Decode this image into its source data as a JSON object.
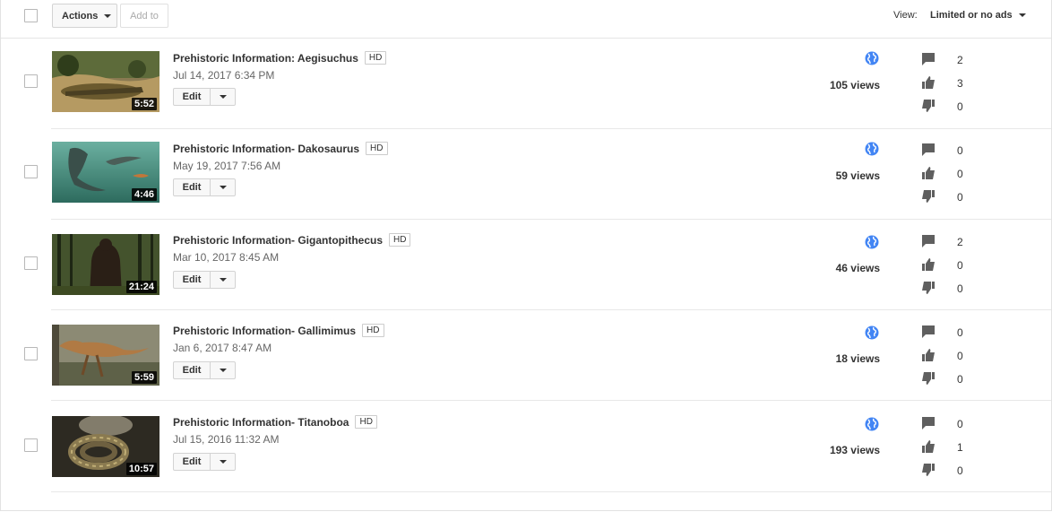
{
  "toolbar": {
    "actions_label": "Actions",
    "add_to_label": "Add to",
    "view_label": "View:",
    "view_value": "Limited or no ads"
  },
  "videos": [
    {
      "title": "Prehistoric Information: Aegisuchus",
      "badge": "HD",
      "date": "Jul 14, 2017 6:34 PM",
      "duration": "5:52",
      "views": "105 views",
      "comments": "2",
      "likes": "3",
      "dislikes": "0",
      "edit": "Edit"
    },
    {
      "title": "Prehistoric Information- Dakosaurus",
      "badge": "HD",
      "date": "May 19, 2017 7:56 AM",
      "duration": "4:46",
      "views": "59 views",
      "comments": "0",
      "likes": "0",
      "dislikes": "0",
      "edit": "Edit"
    },
    {
      "title": "Prehistoric Information- Gigantopithecus",
      "badge": "HD",
      "date": "Mar 10, 2017 8:45 AM",
      "duration": "21:24",
      "views": "46 views",
      "comments": "2",
      "likes": "0",
      "dislikes": "0",
      "edit": "Edit"
    },
    {
      "title": "Prehistoric Information- Gallimimus",
      "badge": "HD",
      "date": "Jan 6, 2017 8:47 AM",
      "duration": "5:59",
      "views": "18 views",
      "comments": "0",
      "likes": "0",
      "dislikes": "0",
      "edit": "Edit"
    },
    {
      "title": "Prehistoric Information- Titanoboa",
      "badge": "HD",
      "date": "Jul 15, 2016 11:32 AM",
      "duration": "10:57",
      "views": "193 views",
      "comments": "0",
      "likes": "1",
      "dislikes": "0",
      "edit": "Edit"
    }
  ],
  "colors": {
    "globe": "#4285f4",
    "icon_gray": "#5f5f5f"
  }
}
